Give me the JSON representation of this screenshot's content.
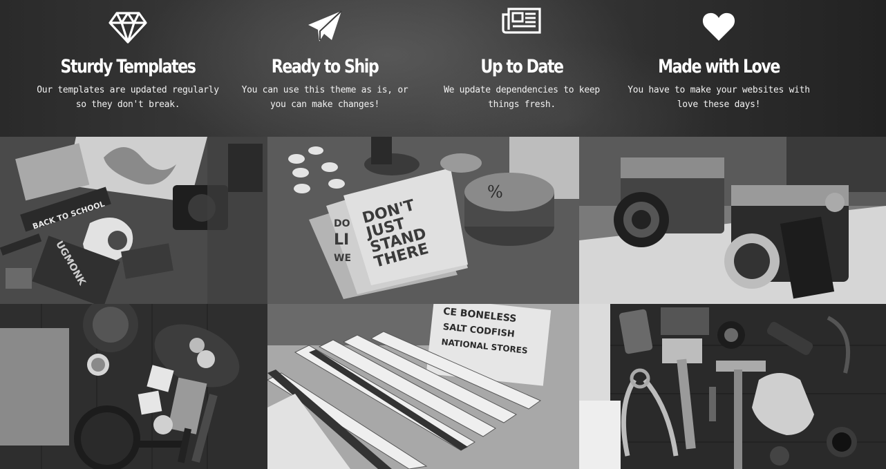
{
  "features": [
    {
      "icon": "diamond-icon",
      "title": "Sturdy Templates",
      "text": "Our templates are updated regularly so they don't break."
    },
    {
      "icon": "paper-plane-icon",
      "title": "Ready to Ship",
      "text": "You can use this theme as is, or you can make changes!"
    },
    {
      "icon": "newspaper-icon",
      "title": "Up to Date",
      "text": "We update dependencies to keep things fresh."
    },
    {
      "icon": "heart-icon",
      "title": "Made with Love",
      "text": "You have to make your websites with love these days!"
    }
  ],
  "gallery": {
    "tiles": [
      {
        "subject": "flat-lay-letterpress",
        "pennant": "BACK TO SCHOOL",
        "tag": "UGMONK"
      },
      {
        "subject": "notebooks",
        "notebook_text": [
          "DON'T",
          "JUST",
          "STAND",
          "THERE"
        ],
        "back_text": [
          "DO",
          "LI",
          "WE"
        ]
      },
      {
        "subject": "vintage-cameras"
      },
      {
        "subject": "kitchen-flat-lay"
      },
      {
        "subject": "folding-rulers",
        "box_text": [
          "CE BONELESS",
          "SALT CODFISH",
          "NATIONAL STORES"
        ]
      },
      {
        "subject": "tools-flat-lay"
      }
    ]
  }
}
